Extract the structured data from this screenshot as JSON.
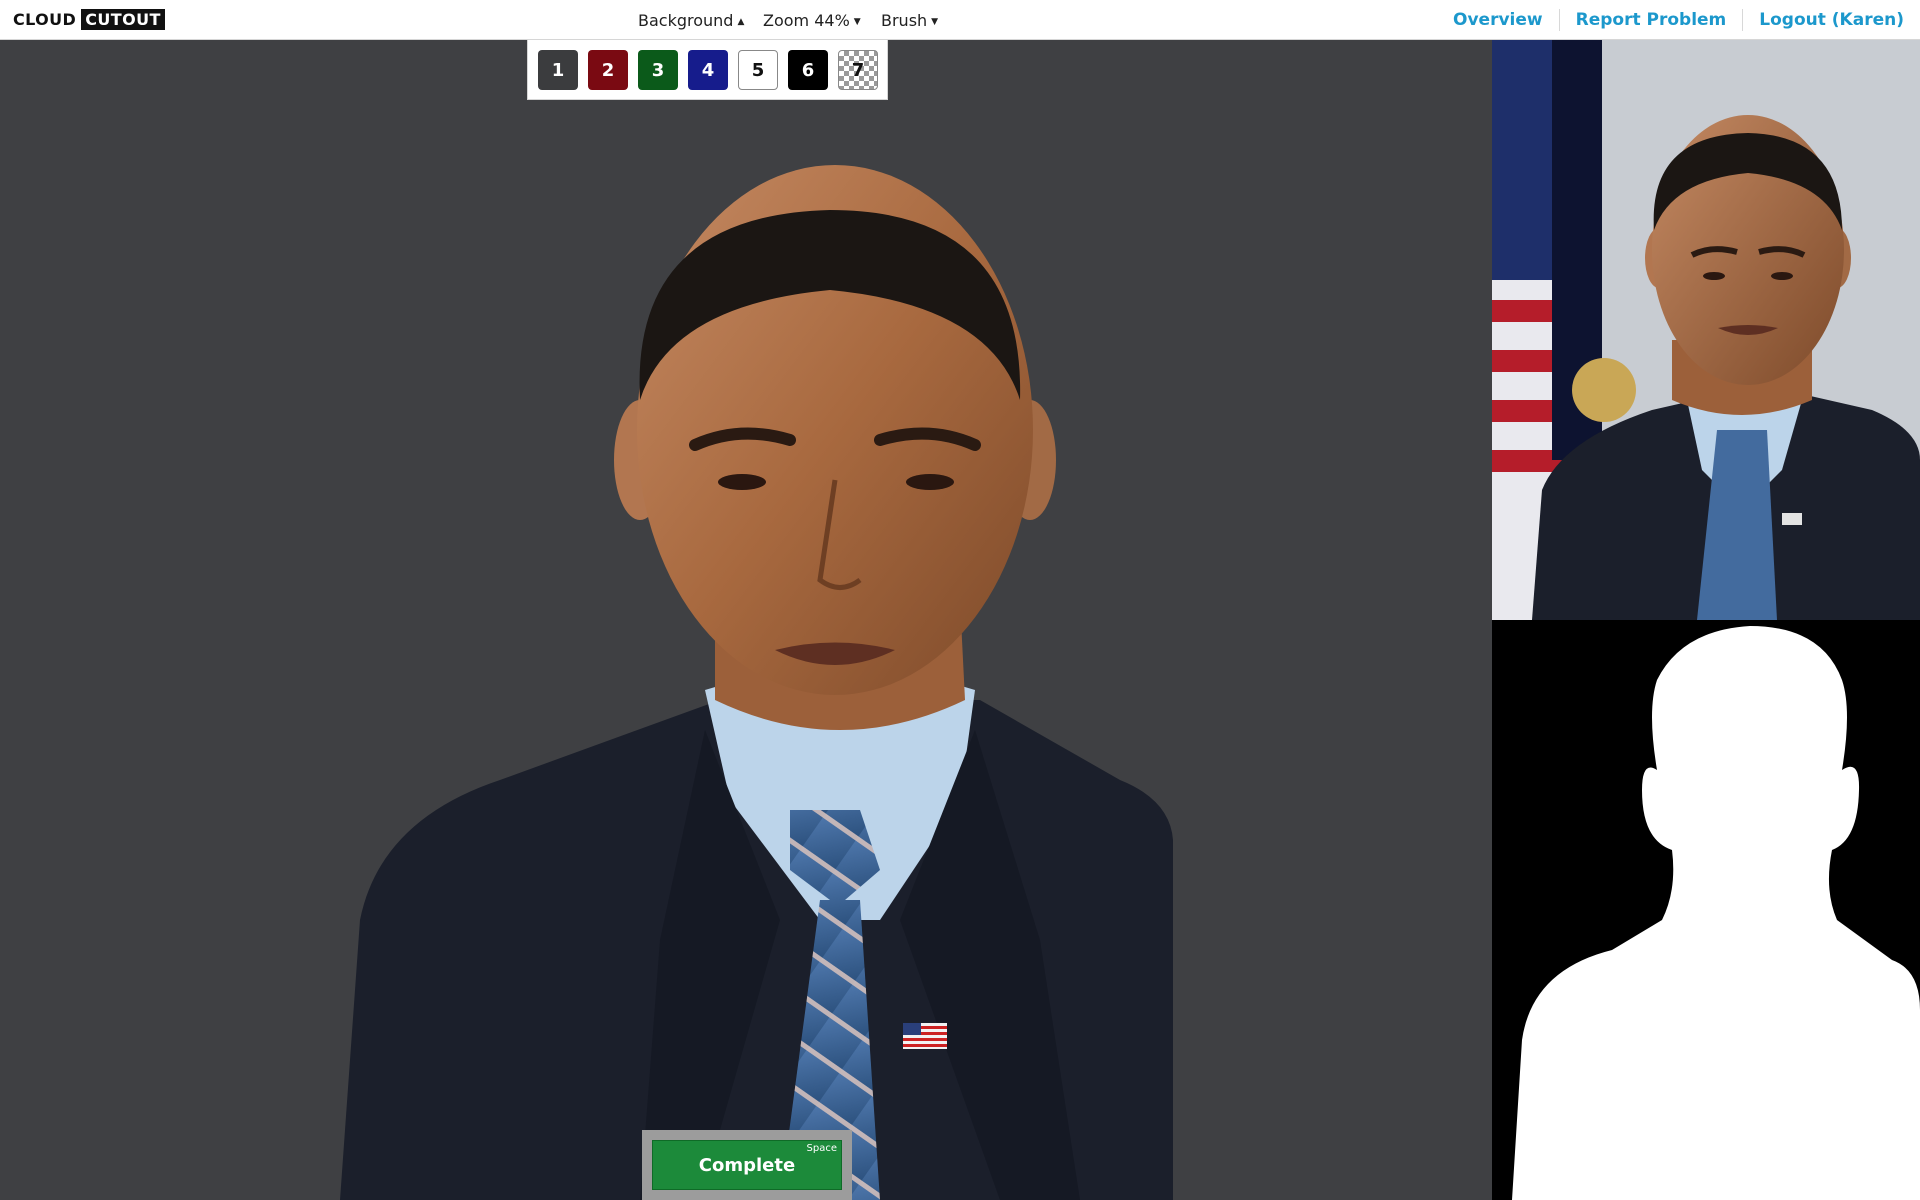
{
  "app": {
    "logo_part1": "CLOUD",
    "logo_part2": "CUTOUT"
  },
  "menus": {
    "background": "Background",
    "background_caret": "▲",
    "zoom": "Zoom 44%",
    "zoom_caret": "▼",
    "brush": "Brush",
    "brush_caret": "▼"
  },
  "links": {
    "overview": "Overview",
    "report": "Report Problem",
    "logout": "Logout (Karen)"
  },
  "background_swatches": [
    {
      "label": "1",
      "color": "#3b3c3e"
    },
    {
      "label": "2",
      "color": "#7a0a12"
    },
    {
      "label": "3",
      "color": "#0b5a1a"
    },
    {
      "label": "4",
      "color": "#161c8c"
    },
    {
      "label": "5",
      "color": "#ffffff"
    },
    {
      "label": "6",
      "color": "#000000"
    },
    {
      "label": "7",
      "color": "transparent"
    }
  ],
  "complete": {
    "label": "Complete",
    "shortcut": "Space"
  },
  "colors": {
    "canvas_bg": "#3f4043",
    "link": "#1c98cc",
    "complete": "#1c8a3a"
  }
}
